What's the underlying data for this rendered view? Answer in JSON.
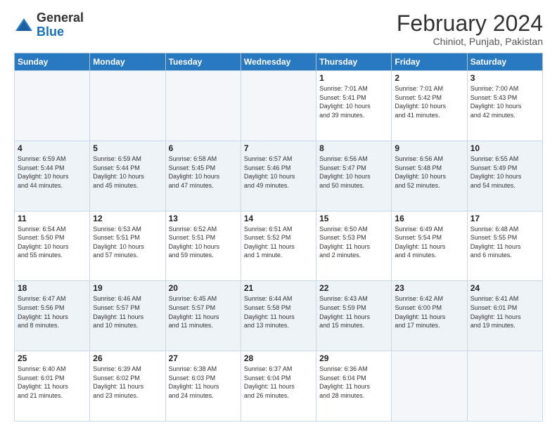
{
  "header": {
    "logo_general": "General",
    "logo_blue": "Blue",
    "title": "February 2024",
    "subtitle": "Chiniot, Punjab, Pakistan"
  },
  "weekdays": [
    "Sunday",
    "Monday",
    "Tuesday",
    "Wednesday",
    "Thursday",
    "Friday",
    "Saturday"
  ],
  "weeks": [
    [
      {
        "day": "",
        "info": ""
      },
      {
        "day": "",
        "info": ""
      },
      {
        "day": "",
        "info": ""
      },
      {
        "day": "",
        "info": ""
      },
      {
        "day": "1",
        "info": "Sunrise: 7:01 AM\nSunset: 5:41 PM\nDaylight: 10 hours\nand 39 minutes."
      },
      {
        "day": "2",
        "info": "Sunrise: 7:01 AM\nSunset: 5:42 PM\nDaylight: 10 hours\nand 41 minutes."
      },
      {
        "day": "3",
        "info": "Sunrise: 7:00 AM\nSunset: 5:43 PM\nDaylight: 10 hours\nand 42 minutes."
      }
    ],
    [
      {
        "day": "4",
        "info": "Sunrise: 6:59 AM\nSunset: 5:44 PM\nDaylight: 10 hours\nand 44 minutes."
      },
      {
        "day": "5",
        "info": "Sunrise: 6:59 AM\nSunset: 5:44 PM\nDaylight: 10 hours\nand 45 minutes."
      },
      {
        "day": "6",
        "info": "Sunrise: 6:58 AM\nSunset: 5:45 PM\nDaylight: 10 hours\nand 47 minutes."
      },
      {
        "day": "7",
        "info": "Sunrise: 6:57 AM\nSunset: 5:46 PM\nDaylight: 10 hours\nand 49 minutes."
      },
      {
        "day": "8",
        "info": "Sunrise: 6:56 AM\nSunset: 5:47 PM\nDaylight: 10 hours\nand 50 minutes."
      },
      {
        "day": "9",
        "info": "Sunrise: 6:56 AM\nSunset: 5:48 PM\nDaylight: 10 hours\nand 52 minutes."
      },
      {
        "day": "10",
        "info": "Sunrise: 6:55 AM\nSunset: 5:49 PM\nDaylight: 10 hours\nand 54 minutes."
      }
    ],
    [
      {
        "day": "11",
        "info": "Sunrise: 6:54 AM\nSunset: 5:50 PM\nDaylight: 10 hours\nand 55 minutes."
      },
      {
        "day": "12",
        "info": "Sunrise: 6:53 AM\nSunset: 5:51 PM\nDaylight: 10 hours\nand 57 minutes."
      },
      {
        "day": "13",
        "info": "Sunrise: 6:52 AM\nSunset: 5:51 PM\nDaylight: 10 hours\nand 59 minutes."
      },
      {
        "day": "14",
        "info": "Sunrise: 6:51 AM\nSunset: 5:52 PM\nDaylight: 11 hours\nand 1 minute."
      },
      {
        "day": "15",
        "info": "Sunrise: 6:50 AM\nSunset: 5:53 PM\nDaylight: 11 hours\nand 2 minutes."
      },
      {
        "day": "16",
        "info": "Sunrise: 6:49 AM\nSunset: 5:54 PM\nDaylight: 11 hours\nand 4 minutes."
      },
      {
        "day": "17",
        "info": "Sunrise: 6:48 AM\nSunset: 5:55 PM\nDaylight: 11 hours\nand 6 minutes."
      }
    ],
    [
      {
        "day": "18",
        "info": "Sunrise: 6:47 AM\nSunset: 5:56 PM\nDaylight: 11 hours\nand 8 minutes."
      },
      {
        "day": "19",
        "info": "Sunrise: 6:46 AM\nSunset: 5:57 PM\nDaylight: 11 hours\nand 10 minutes."
      },
      {
        "day": "20",
        "info": "Sunrise: 6:45 AM\nSunset: 5:57 PM\nDaylight: 11 hours\nand 11 minutes."
      },
      {
        "day": "21",
        "info": "Sunrise: 6:44 AM\nSunset: 5:58 PM\nDaylight: 11 hours\nand 13 minutes."
      },
      {
        "day": "22",
        "info": "Sunrise: 6:43 AM\nSunset: 5:59 PM\nDaylight: 11 hours\nand 15 minutes."
      },
      {
        "day": "23",
        "info": "Sunrise: 6:42 AM\nSunset: 6:00 PM\nDaylight: 11 hours\nand 17 minutes."
      },
      {
        "day": "24",
        "info": "Sunrise: 6:41 AM\nSunset: 6:01 PM\nDaylight: 11 hours\nand 19 minutes."
      }
    ],
    [
      {
        "day": "25",
        "info": "Sunrise: 6:40 AM\nSunset: 6:01 PM\nDaylight: 11 hours\nand 21 minutes."
      },
      {
        "day": "26",
        "info": "Sunrise: 6:39 AM\nSunset: 6:02 PM\nDaylight: 11 hours\nand 23 minutes."
      },
      {
        "day": "27",
        "info": "Sunrise: 6:38 AM\nSunset: 6:03 PM\nDaylight: 11 hours\nand 24 minutes."
      },
      {
        "day": "28",
        "info": "Sunrise: 6:37 AM\nSunset: 6:04 PM\nDaylight: 11 hours\nand 26 minutes."
      },
      {
        "day": "29",
        "info": "Sunrise: 6:36 AM\nSunset: 6:04 PM\nDaylight: 11 hours\nand 28 minutes."
      },
      {
        "day": "",
        "info": ""
      },
      {
        "day": "",
        "info": ""
      }
    ]
  ]
}
